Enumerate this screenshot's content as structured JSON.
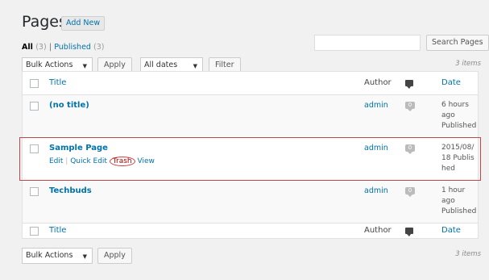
{
  "header": {
    "title": "Pages",
    "add_new": "Add New"
  },
  "filters": {
    "all_label": "All",
    "all_count": "(3)",
    "separator": "|",
    "published_label": "Published",
    "published_count": "(3)"
  },
  "search": {
    "placeholder": "",
    "button": "Search Pages"
  },
  "top_nav": {
    "bulk_actions": "Bulk Actions",
    "apply": "Apply",
    "all_dates": "All dates",
    "filter": "Filter",
    "items": "3 items"
  },
  "bottom_nav": {
    "bulk_actions": "Bulk Actions",
    "apply": "Apply",
    "items": "3 items"
  },
  "table": {
    "columns": {
      "title": "Title",
      "author": "Author",
      "date": "Date"
    },
    "rows": [
      {
        "title": "(no title)",
        "author": "admin",
        "comments": "0",
        "date": "6 hours ago Published"
      },
      {
        "title": "Sample Page",
        "author": "admin",
        "comments": "0",
        "date": "2015/08/18 Published",
        "actions": {
          "edit": "Edit",
          "quick_edit": "Quick Edit",
          "trash": "Trash",
          "view": "View"
        }
      },
      {
        "title": "Techbuds",
        "author": "admin",
        "comments": "0",
        "date": "1 hour ago Published"
      }
    ]
  },
  "colors": {
    "link": "#0073aa",
    "highlight": "#c2464b",
    "background": "#f1f1f1"
  }
}
